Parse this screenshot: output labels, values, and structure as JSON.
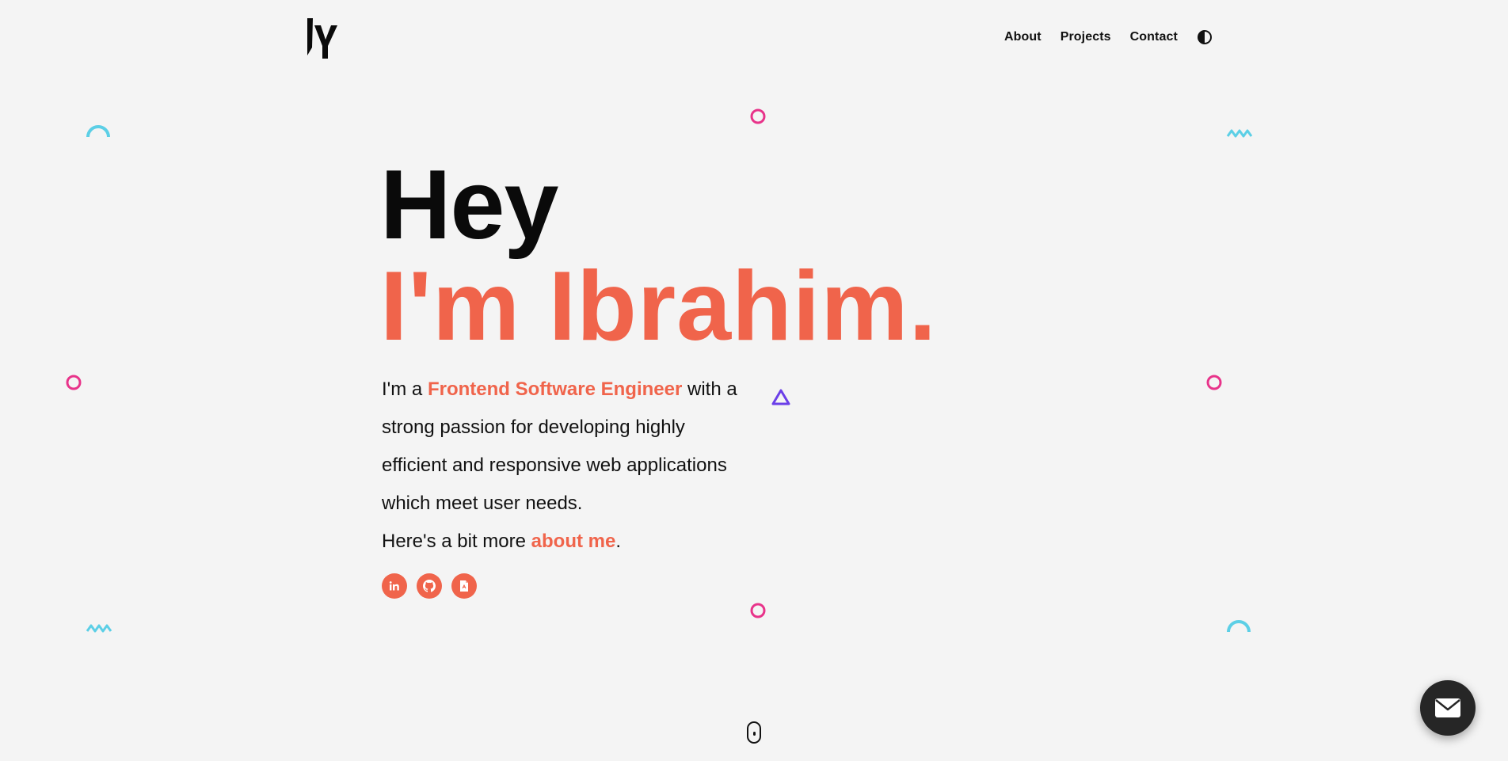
{
  "logo": {
    "icon": "iy-monogram-logo-icon"
  },
  "nav": {
    "items": [
      {
        "label": "About"
      },
      {
        "label": "Projects"
      },
      {
        "label": "Contact"
      }
    ],
    "theme_toggle_icon": "half-circle-contrast-icon"
  },
  "hero": {
    "greeting": "Hey",
    "name_line": "I'm Ibrahim.",
    "intro_prefix": "I'm a ",
    "role": "Frontend Software Engineer",
    "intro_rest": " with a strong passion for developing highly efficient and responsive web applications which meet user needs.",
    "more_prefix": "Here's a bit more ",
    "more_link": "about me",
    "more_suffix": "."
  },
  "socials": [
    {
      "name": "linkedin",
      "icon": "linkedin-icon"
    },
    {
      "name": "github",
      "icon": "github-icon"
    },
    {
      "name": "resume",
      "icon": "document-icon"
    }
  ],
  "colors": {
    "accent": "#f0644b",
    "background": "#f4f4f4",
    "text": "#111111",
    "deco_pink": "#e8338a",
    "deco_cyan": "#5ccfe6",
    "deco_purple": "#6b3fe8",
    "fab": "#262626"
  },
  "scroll_indicator_icon": "mouse-scroll-icon",
  "contact_fab_icon": "envelope-icon"
}
